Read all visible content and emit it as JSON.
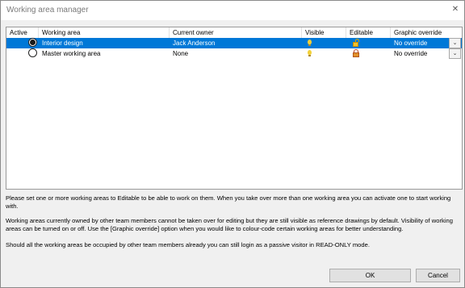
{
  "window": {
    "title": "Working area manager",
    "close_glyph": "✕"
  },
  "columns": [
    "Active",
    "Working area",
    "Current owner",
    "Visible",
    "Editable",
    "Graphic override"
  ],
  "rows": [
    {
      "active": true,
      "area": "Interior design",
      "owner": "Jack Anderson",
      "visible_icon": "lightbulb-icon",
      "editable_icon": "lock-open-icon",
      "graphic_override": "No override",
      "selected": true
    },
    {
      "active": false,
      "area": "Master working area",
      "owner": "None",
      "visible_icon": "lightbulb-icon",
      "editable_icon": "lock-closed-icon",
      "graphic_override": "No override",
      "selected": false
    }
  ],
  "messages": [
    "Please set one or more working areas to Editable to be able to work on them. When you take over more than one working area you can activate one to start working with.",
    "Working areas currently owned by other team members cannot be taken over for editing but they are still visible as reference drawings by default. Visibility of working areas can be turned on or off. Use the [Graphic override] option when you would like to colour-code certain working areas for better understanding.",
    "Should all the working areas be occupied by other team members already you can still login as a passive visitor in READ-ONLY mode."
  ],
  "buttons": {
    "ok": "OK",
    "cancel": "Cancel"
  },
  "colors": {
    "selection": "#0078d7",
    "dialog_bg": "#f0f0f0"
  }
}
